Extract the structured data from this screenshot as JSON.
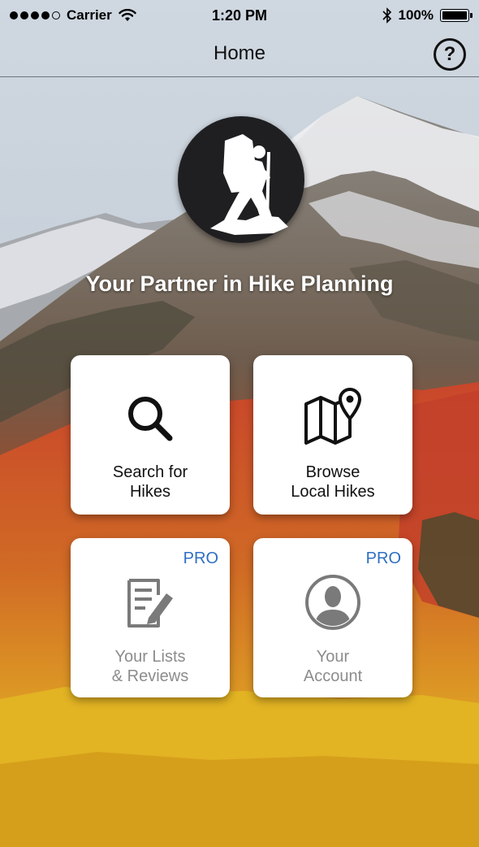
{
  "status_bar": {
    "carrier": "Carrier",
    "time": "1:20 PM",
    "battery": "100%",
    "battery_level": 1.0
  },
  "nav": {
    "title": "Home",
    "help_label": "?"
  },
  "tagline": "Your Partner in Hike Planning",
  "tiles": [
    {
      "label": "Search for\nHikes",
      "icon": "search-icon",
      "badge": ""
    },
    {
      "label": "Browse\nLocal Hikes",
      "icon": "map-pin-icon",
      "badge": ""
    },
    {
      "label": "Your Lists\n& Reviews",
      "icon": "edit-list-icon",
      "badge": "PRO"
    },
    {
      "label": "Your\nAccount",
      "icon": "user-icon",
      "badge": "PRO"
    }
  ],
  "colors": {
    "pro_badge": "#2f6fc2",
    "logo_bg": "#1f1f21",
    "disabled_text": "#8c8c8c"
  }
}
